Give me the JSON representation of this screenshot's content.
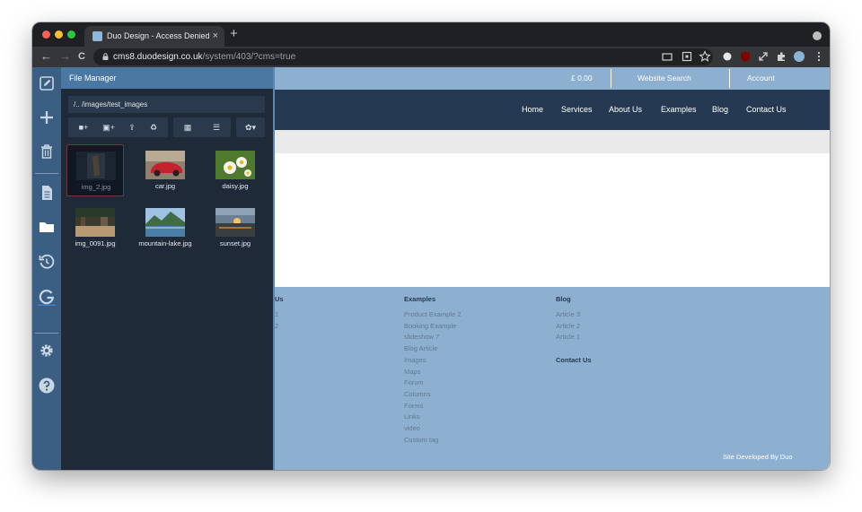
{
  "browser": {
    "tab_title": "Duo Design - Access Denied",
    "tab_close": "×",
    "new_tab": "+",
    "url_host": "cms8.duodesign.co.uk",
    "url_path": "/system/403/?cms=true",
    "back": "←",
    "forward": "→",
    "reload": "C"
  },
  "cms_sidebar": {
    "icons": [
      "edit-icon",
      "add-icon",
      "trash-icon",
      "page-icon",
      "folder-icon",
      "history-icon",
      "google-icon",
      "gear-icon",
      "help-icon"
    ]
  },
  "file_manager": {
    "title": "File Manager",
    "path": "/.. /images/test_images",
    "tools": {
      "new_folder": "■+",
      "upload_image": "▣+",
      "upload": "⇪",
      "recycle": "♻",
      "grid_view": "▦",
      "list_view": "☰",
      "settings": "✿▾"
    },
    "files": [
      {
        "name": "img_2.jpg",
        "selected": true
      },
      {
        "name": "car.jpg",
        "selected": false
      },
      {
        "name": "daisy.jpg",
        "selected": false
      },
      {
        "name": "img_0091.jpg",
        "selected": false
      },
      {
        "name": "mountain-lake.jpg",
        "selected": false
      },
      {
        "name": "sunset.jpg",
        "selected": false
      }
    ]
  },
  "site": {
    "topbar": {
      "basket": "£ 0.00",
      "search": "Website Search",
      "account": "Account"
    },
    "nav": [
      "Home",
      "Services",
      "About Us",
      "Examples",
      "Blog",
      "Contact Us"
    ],
    "footer": {
      "col1": {
        "heading": "Us",
        "links": [
          "1",
          "2"
        ]
      },
      "col2": {
        "heading": "Examples",
        "links": [
          "Product Example 2",
          "Booking Example",
          "slideshow 7",
          "Blog Article",
          "Images",
          "Maps",
          "Forum",
          "Columns",
          "Forms",
          "Links",
          "video",
          "Custom tag"
        ]
      },
      "col3": {
        "heading": "Blog",
        "links": [
          "Article 3",
          "Article 2",
          "Article 1"
        ]
      },
      "col4": {
        "heading": "Contact Us"
      },
      "credit": "Site Developed By Duo"
    }
  },
  "colors": {
    "cms_blue": "#3b5f82",
    "fm_dark": "#1e2a38",
    "site_navy": "#253a52",
    "site_light_blue": "#8eb0d0"
  }
}
